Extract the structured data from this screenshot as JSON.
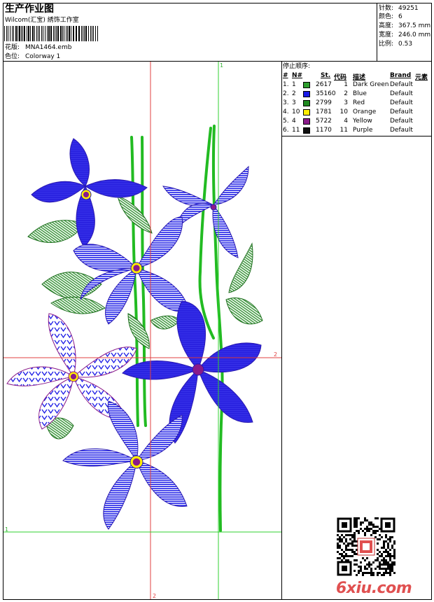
{
  "header": {
    "title": "生产作业图",
    "studio": "Wilcom(汇宝) 綉饰工作室",
    "design_label": "花版:",
    "design_value": "MNA1464.emb",
    "colorway_label": "色位:",
    "colorway_value": "Colorway 1"
  },
  "stats": [
    {
      "label": "针数:",
      "value": "49251"
    },
    {
      "label": "颜色:",
      "value": "6"
    },
    {
      "label": "高度:",
      "value": "367.5 mm"
    },
    {
      "label": "宽度:",
      "value": "246.0 mm"
    },
    {
      "label": "比例:",
      "value": "0.53"
    }
  ],
  "stop_sequence": {
    "title": "停止顺序:",
    "headers": {
      "num": "#",
      "n": "N#",
      "st": "St.",
      "code": "代码",
      "desc": "描述",
      "brand": "Brand",
      "elem": "元素"
    },
    "rows": [
      {
        "num": "1.",
        "n": "1",
        "color": "#2e9e2e",
        "st": "2617",
        "code": "1",
        "desc": "Dark Green",
        "brand": "Default"
      },
      {
        "num": "2.",
        "n": "2",
        "color": "#1a1ae6",
        "st": "35160",
        "code": "2",
        "desc": "Blue",
        "brand": "Default"
      },
      {
        "num": "3.",
        "n": "3",
        "color": "#1f8a1f",
        "st": "2799",
        "code": "3",
        "desc": "Red",
        "brand": "Default"
      },
      {
        "num": "4.",
        "n": "10",
        "color": "#ffee00",
        "st": "1781",
        "code": "10",
        "desc": "Orange",
        "brand": "Default"
      },
      {
        "num": "5.",
        "n": "4",
        "color": "#8a1a8a",
        "st": "5722",
        "code": "4",
        "desc": "Yellow",
        "brand": "Default"
      },
      {
        "num": "6.",
        "n": "11",
        "color": "#111111",
        "st": "1170",
        "code": "11",
        "desc": "Purple",
        "brand": "Default"
      }
    ]
  },
  "guides": {
    "v1": "1",
    "v2": "2",
    "h1": "1",
    "h2": "2"
  },
  "watermark": "6xiu.com",
  "colors": {
    "blue": "#1a1ae6",
    "green": "#22bb22",
    "leaf": "#2e8f2e",
    "purple": "#8a1a8a",
    "yellow": "#ffee00",
    "guide_red": "#e04040",
    "guide_green": "#30d030"
  }
}
